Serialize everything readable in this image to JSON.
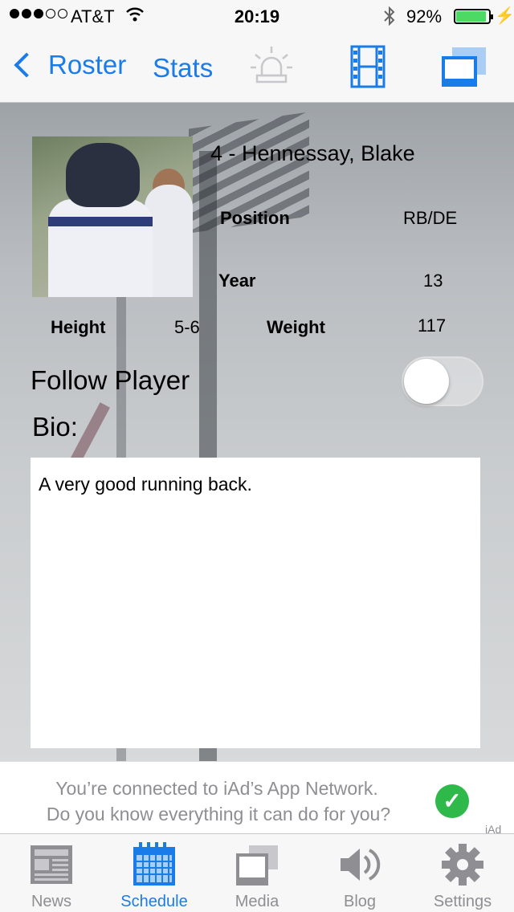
{
  "status_bar": {
    "carrier": "AT&T",
    "time": "20:19",
    "battery_pct": "92%",
    "battery_level": 0.92,
    "battery_color": "#4cd964"
  },
  "nav": {
    "back_label": "Roster",
    "stats_label": "Stats",
    "icons": [
      "siren-icon",
      "film-icon",
      "screen-icon"
    ],
    "accent": "#1a7ce8"
  },
  "player": {
    "name": "4 - Hennessay, Blake",
    "position_label": "Position",
    "position": "RB/DE",
    "year_label": "Year",
    "year": "13",
    "height_label": "Height",
    "height": "5-6",
    "weight_label": "Weight",
    "weight": "117",
    "follow_label": "Follow Player",
    "follow_on": false,
    "bio_label": "Bio:",
    "bio": "A very good running back."
  },
  "ad": {
    "line1": "You’re connected to iAd’s App Network.",
    "line2": "Do you know everything it can do for you?",
    "tag": "iAd"
  },
  "tabs": [
    {
      "label": "News",
      "icon": "newspaper-icon",
      "active": false
    },
    {
      "label": "Schedule",
      "icon": "calendar-icon",
      "active": true
    },
    {
      "label": "Media",
      "icon": "media-icon",
      "active": false
    },
    {
      "label": "Blog",
      "icon": "speaker-icon",
      "active": false
    },
    {
      "label": "Settings",
      "icon": "gear-icon",
      "active": false
    }
  ]
}
